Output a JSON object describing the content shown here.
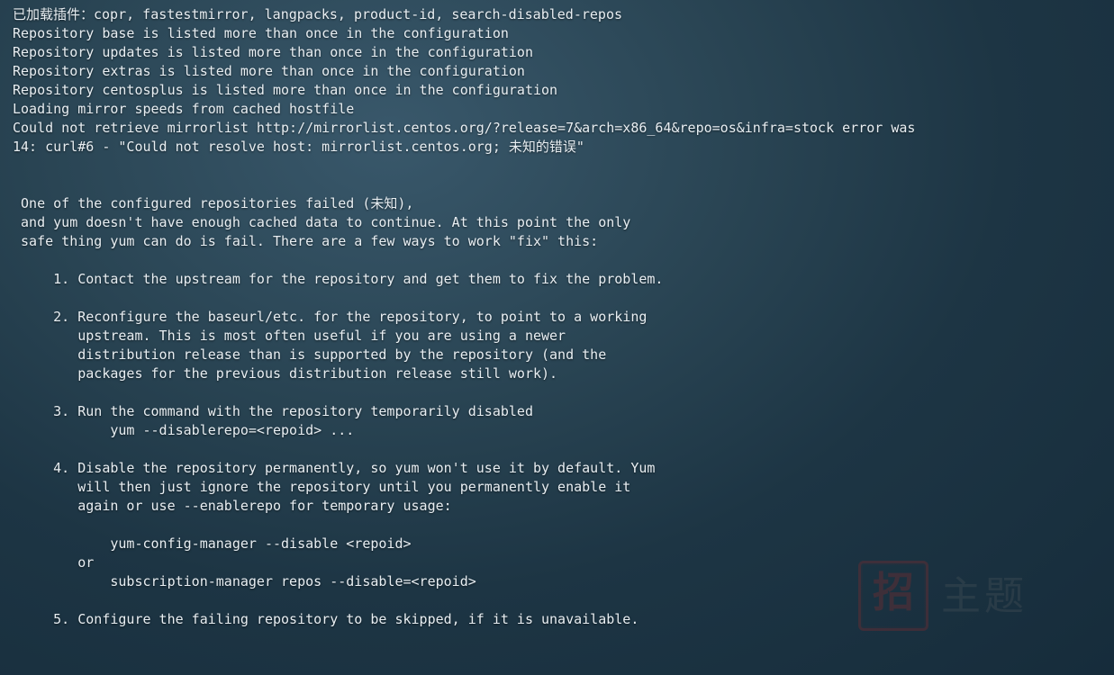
{
  "terminal": {
    "lines": [
      "已加载插件：copr, fastestmirror, langpacks, product-id, search-disabled-repos",
      "Repository base is listed more than once in the configuration",
      "Repository updates is listed more than once in the configuration",
      "Repository extras is listed more than once in the configuration",
      "Repository centosplus is listed more than once in the configuration",
      "Loading mirror speeds from cached hostfile",
      "Could not retrieve mirrorlist http://mirrorlist.centos.org/?release=7&arch=x86_64&repo=os&infra=stock error was",
      "14: curl#6 - \"Could not resolve host: mirrorlist.centos.org; 未知的错误\"",
      "",
      "",
      " One of the configured repositories failed (未知),",
      " and yum doesn't have enough cached data to continue. At this point the only",
      " safe thing yum can do is fail. There are a few ways to work \"fix\" this:",
      "",
      "     1. Contact the upstream for the repository and get them to fix the problem.",
      "",
      "     2. Reconfigure the baseurl/etc. for the repository, to point to a working",
      "        upstream. This is most often useful if you are using a newer",
      "        distribution release than is supported by the repository (and the",
      "        packages for the previous distribution release still work).",
      "",
      "     3. Run the command with the repository temporarily disabled",
      "            yum --disablerepo=<repoid> ...",
      "",
      "     4. Disable the repository permanently, so yum won't use it by default. Yum",
      "        will then just ignore the repository until you permanently enable it",
      "        again or use --enablerepo for temporary usage:",
      "",
      "            yum-config-manager --disable <repoid>",
      "        or",
      "            subscription-manager repos --disable=<repoid>",
      "",
      "     5. Configure the failing repository to be skipped, if it is unavailable."
    ]
  },
  "watermark": {
    "stamp": "招",
    "text": "主题"
  }
}
